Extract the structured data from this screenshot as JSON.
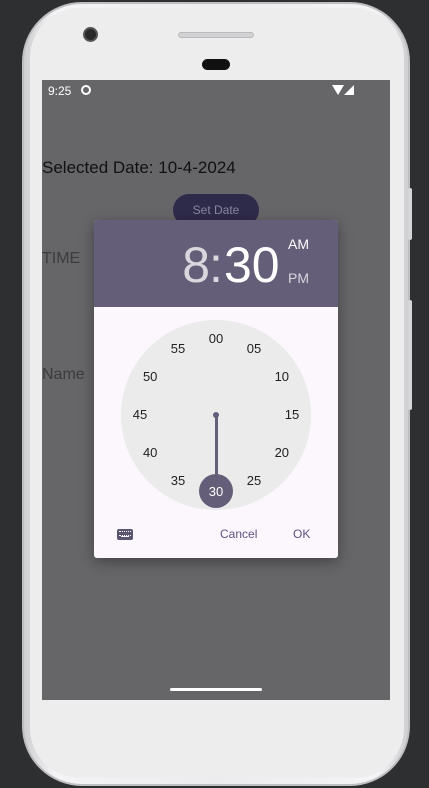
{
  "statusbar": {
    "time": "9:25",
    "icons": [
      "app-notification-icon",
      "wifi-icon",
      "signal-icon"
    ]
  },
  "app": {
    "selected_date_text": "Selected Date: 10-4-2024",
    "set_date_button": "Set Date",
    "time_label": "TIME",
    "name_label": "Name"
  },
  "time_picker": {
    "hour": "8",
    "separator": ":",
    "minute": "30",
    "am_label": "AM",
    "pm_label": "PM",
    "selected_period": "AM",
    "clock_numbers": [
      "00",
      "05",
      "10",
      "15",
      "20",
      "25",
      "30",
      "35",
      "40",
      "45",
      "50",
      "55"
    ],
    "selected_minute": "30",
    "keyboard_icon": "keyboard-icon",
    "cancel_label": "Cancel",
    "ok_label": "OK"
  },
  "colors": {
    "header": "#645e78",
    "dialog_bg": "#fbf7fc",
    "scrim": "#666568",
    "accent_text": "#5b5280"
  }
}
